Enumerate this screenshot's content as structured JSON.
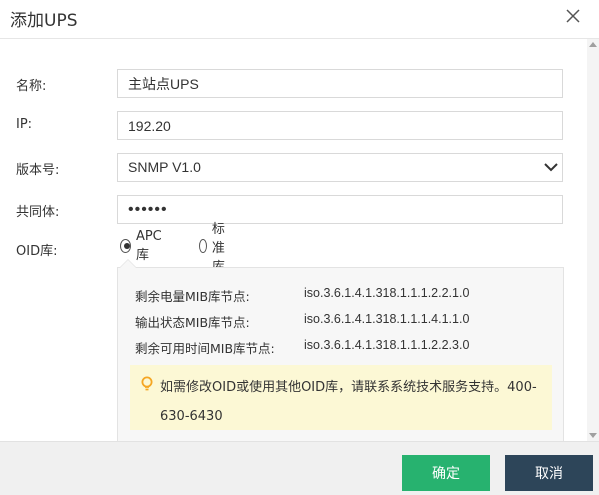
{
  "dialog": {
    "title": "添加UPS",
    "close_icon": "close-icon"
  },
  "form": {
    "name_label": "名称:",
    "name_value": "主站点UPS",
    "ip_label": "IP:",
    "ip_value": "192.20",
    "version_label": "版本号:",
    "version_value": "SNMP V1.0",
    "community_label": "共同体:",
    "community_value": "••••••",
    "oid_label": "OID库:",
    "oid_options": [
      {
        "label": "APC库",
        "checked": true
      },
      {
        "label": "标准库",
        "checked": false
      }
    ]
  },
  "oid_panel": {
    "rows": [
      {
        "label": "剩余电量MIB库节点:",
        "value": "iso.3.6.1.4.1.318.1.1.1.2.2.1.0"
      },
      {
        "label": "输出状态MIB库节点:",
        "value": "iso.3.6.1.4.1.318.1.1.1.4.1.1.0"
      },
      {
        "label": "剩余可用时间MIB库节点:",
        "value": "iso.3.6.1.4.1.318.1.1.1.2.2.3.0"
      }
    ],
    "notice": "如需修改OID或使用其他OID库，请联系系统技术服务支持。400-630-6430",
    "notice_icon": "lightbulb-icon"
  },
  "footer": {
    "ok_label": "确定",
    "cancel_label": "取消"
  },
  "colors": {
    "ok_button": "#27b26f",
    "cancel_button": "#2d4559",
    "notice_bg": "#fcf8d5",
    "notice_icon": "#f5a623"
  }
}
